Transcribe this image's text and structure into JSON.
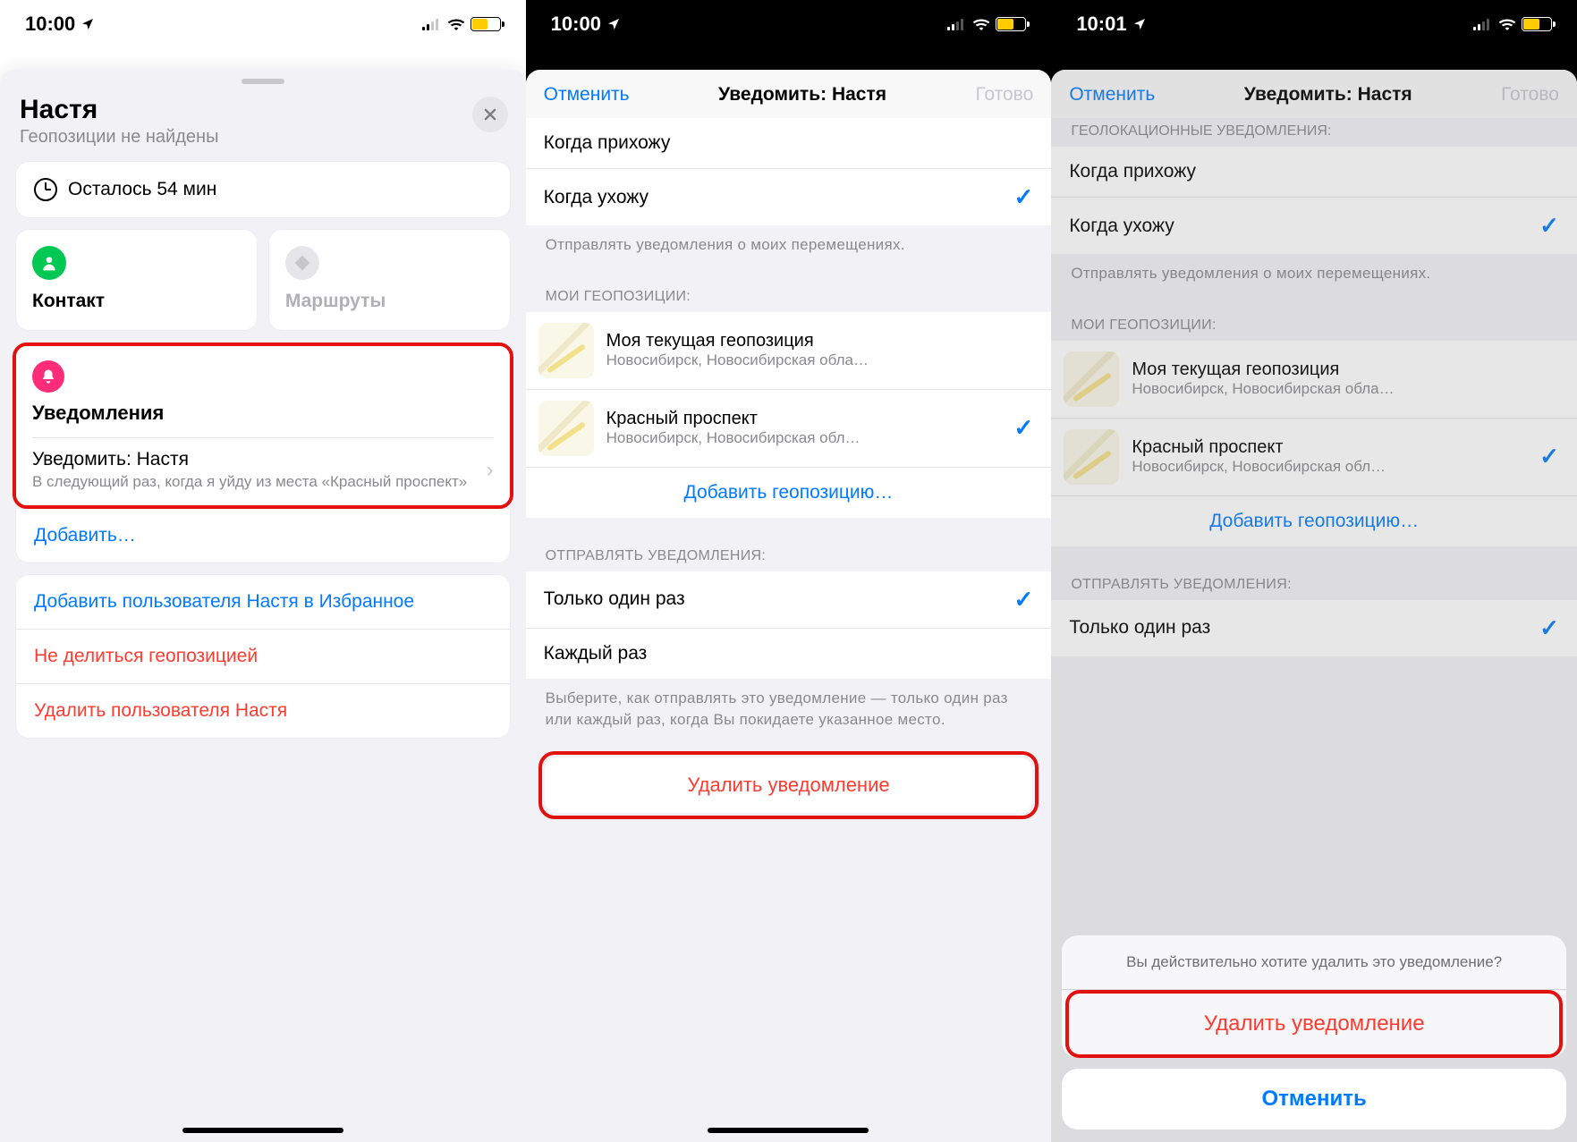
{
  "status": {
    "time1": "10:00",
    "time2": "10:00",
    "time3": "10:01"
  },
  "panel1": {
    "name": "Настя",
    "subtitle": "Геопозиции не найдены",
    "remaining": "Осталось 54 мин",
    "contact": "Контакт",
    "routes": "Маршруты",
    "notifications_header": "Уведомления",
    "notify_title": "Уведомить: Настя",
    "notify_sub": "В следующий раз, когда я уйду из места «Красный проспект»",
    "add": "Добавить…",
    "fav": "Добавить пользователя Настя в Избранное",
    "stop_share": "Не делиться геопозицией",
    "delete_user": "Удалить пользователя Настя"
  },
  "panel2": {
    "cancel": "Отменить",
    "title": "Уведомить: Настя",
    "done": "Готово",
    "when_arrive": "Когда прихожу",
    "when_leave": "Когда ухожу",
    "caption1": "Отправлять уведомления о моих перемещениях.",
    "my_locations": "МОИ ГЕОПОЗИЦИИ:",
    "loc1_title": "Моя текущая геопозиция",
    "loc1_sub": "Новосибирск, Новосибирская обла…",
    "loc2_title": "Красный проспект",
    "loc2_sub": "Новосибирск, Новосибирская обл…",
    "add_location": "Добавить геопозицию…",
    "send_header": "ОТПРАВЛЯТЬ УВЕДОМЛЕНИЯ:",
    "once": "Только один раз",
    "every": "Каждый раз",
    "caption2": "Выберите, как отправлять это уведомление — только один раз или каждый раз, когда Вы покидаете указанное место.",
    "delete": "Удалить уведомление"
  },
  "panel3": {
    "cancel": "Отменить",
    "title": "Уведомить: Настя",
    "done": "Готово",
    "top_caption": "ГЕОЛОКАЦИОННЫЕ УВЕДОМЛЕНИЯ:",
    "when_arrive": "Когда прихожу",
    "when_leave": "Когда ухожу",
    "caption1": "Отправлять уведомления о моих перемещениях.",
    "my_locations": "МОИ ГЕОПОЗИЦИИ:",
    "loc1_title": "Моя текущая геопозиция",
    "loc1_sub": "Новосибирск, Новосибирская обла…",
    "loc2_title": "Красный проспект",
    "loc2_sub": "Новосибирск, Новосибирская обл…",
    "add_location": "Добавить геопозицию…",
    "send_header": "ОТПРАВЛЯТЬ УВЕДОМЛЕНИЯ:",
    "once": "Только один раз",
    "as_prompt": "Вы действительно хотите удалить это уведомление?",
    "as_delete": "Удалить уведомление",
    "as_cancel": "Отменить"
  }
}
